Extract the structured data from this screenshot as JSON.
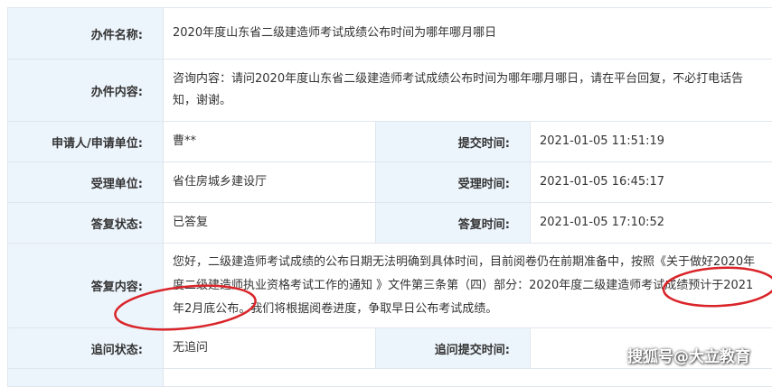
{
  "rows": {
    "name": {
      "label": "办件名称:",
      "value": "2020年度山东省二级建造师考试成绩公布时间为哪年哪月哪日"
    },
    "content": {
      "label": "办件内容:",
      "value": "咨询内容：请问2020年度山东省二级建造师考试成绩公布时间为哪年哪月哪日，请在平台回复，不必打电话告知，谢谢。"
    },
    "applicant": {
      "label": "申请人/申请单位:",
      "value": "曹**"
    },
    "submit_time": {
      "label": "提交时间:",
      "value": "2021-01-05 11:51:19"
    },
    "accept_unit": {
      "label": "受理单位:",
      "value": "省住房城乡建设厅"
    },
    "accept_time": {
      "label": "受理时间:",
      "value": "2021-01-05 16:45:17"
    },
    "reply_status": {
      "label": "答复状态:",
      "value": "已答复"
    },
    "reply_time": {
      "label": "答复时间:",
      "value": "2021-01-05 17:10:52"
    },
    "reply": {
      "label": "答复内容:",
      "value": "您好，二级建造师考试成绩的公布日期无法明确到具体时间，目前阅卷仍在前期准备中，按照《关于做好2020年度二级建造师执业资格考试工作的通知 》文件第三条第（四）部分：2020年度二级建造师考试成绩预计于2021年2月底公布。我们将根据阅卷进度，争取早日公布考试成绩。"
    },
    "followup_status": {
      "label": "追问状态:",
      "value": "无追问"
    },
    "followup_time": {
      "label": "追问提交时间:",
      "value": ""
    }
  },
  "watermark": "搜狐号@大立教育",
  "colors": {
    "label_bg": "#edf5fc",
    "border": "#dfe6ee",
    "annotation": "#d9252a"
  }
}
